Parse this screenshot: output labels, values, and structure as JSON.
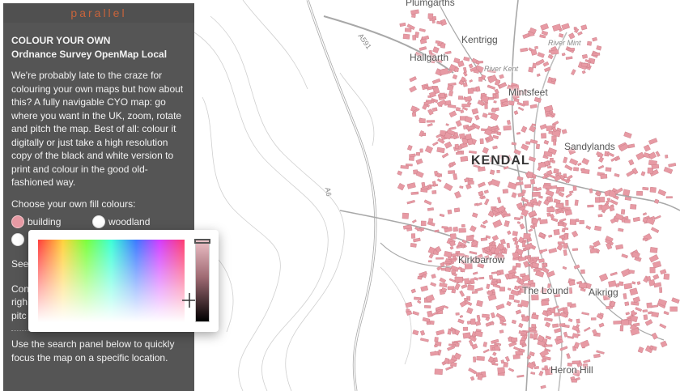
{
  "app": {
    "brand": "parallel"
  },
  "panel": {
    "title": "COLOUR YOUR OWN",
    "subtitle": "Ordnance Survey OpenMap Local",
    "intro": "We're probably late to the craze for colouring your own maps but how about this? A fully navigable CYO map: go where you want in the UK, zoom, rotate and pitch the map. Best of all: colour it digitally or just take a high resolution copy of the black and white version to print and colour in the good old-fashioned way.",
    "fill_prompt": "Choose your own fill colours:",
    "swatches": [
      {
        "label": "building",
        "color": "#e79aa4"
      },
      {
        "label": "woodland",
        "color": "#ffffff"
      },
      {
        "label": "",
        "color": "#ffffff"
      },
      {
        "label": "",
        "color": "#ffffff"
      }
    ],
    "partial_lines": [
      "See",
      "Con",
      "righ",
      "pitc"
    ],
    "search_hint": "Use the search panel below to quickly focus the map on a specific location."
  },
  "picker": {
    "selected_color": "#e79aa4",
    "brightness_level": 1.0
  },
  "map": {
    "places": {
      "kendal": "KENDAL",
      "kentrigg": "Kentrigg",
      "hallgarth": "Hallgarth",
      "mintsfeet": "Mintsfeet",
      "sandylands": "Sandylands",
      "kirkbarrow": "Kirkbarrow",
      "the_lound": "The Lound",
      "aikrigg": "Aikrigg",
      "heron_hill": "Heron Hill",
      "plumgarths": "Plumgarths"
    },
    "small_labels": {
      "river_mint": "River Mint",
      "river_kent": "River Kent",
      "a591": "A591",
      "a6": "A6",
      "a591_south": "A591"
    },
    "colors": {
      "building": "#e79aa4",
      "building_outline": "#c97c86",
      "road": "#9a9a9a",
      "contour": "#c8c8c8"
    }
  }
}
